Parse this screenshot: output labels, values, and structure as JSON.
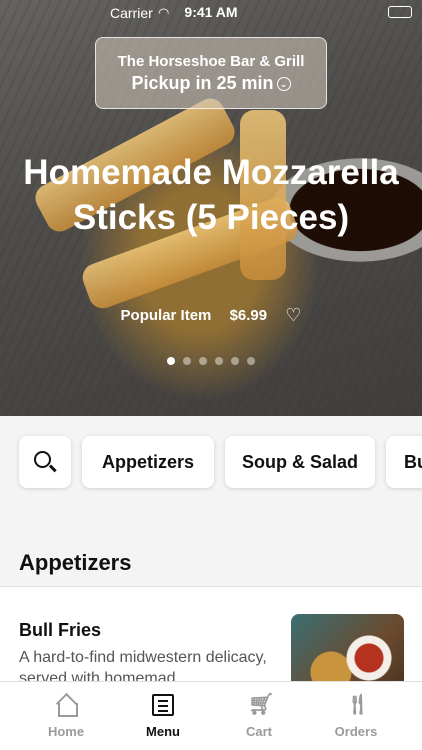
{
  "status_bar": {
    "carrier": "Carrier",
    "time": "9:41 AM"
  },
  "store": {
    "name": "The Horseshoe Bar & Grill",
    "pickup": "Pickup in 25 min"
  },
  "featured": {
    "title": "Homemade Mozzarella Sticks (5 Pieces)",
    "badge": "Popular Item",
    "price": "$6.99",
    "carousel_total": 6,
    "carousel_active": 1
  },
  "categories": [
    "Appetizers",
    "Soup & Salad",
    "Bu"
  ],
  "section": {
    "title": "Appetizers",
    "items": [
      {
        "name": "Bull Fries",
        "description": "A hard-to-find midwestern delicacy, served with homemad..."
      }
    ]
  },
  "tabs": [
    {
      "label": "Home",
      "icon": "home-icon"
    },
    {
      "label": "Menu",
      "icon": "menu-icon"
    },
    {
      "label": "Cart",
      "icon": "cart-icon"
    },
    {
      "label": "Orders",
      "icon": "orders-icon"
    }
  ],
  "active_tab": "Menu",
  "colors": {
    "accent": "#111111",
    "inactive": "#9a9a9a"
  }
}
